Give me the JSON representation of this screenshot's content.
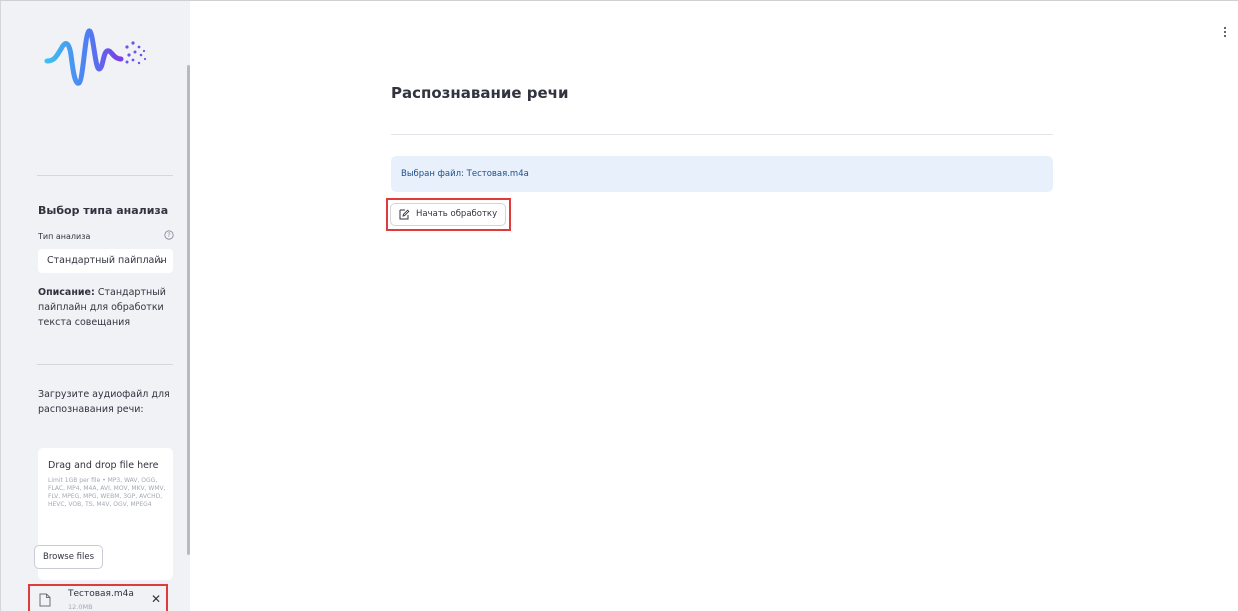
{
  "colors": {
    "sidebar_bg": "#f0f2f6",
    "info_bg": "#e8f1fb",
    "info_text": "#1f4e8a",
    "highlight": "#e03a3a",
    "logo_gradient": [
      "#3ec0f0",
      "#4f7df3",
      "#7b3fe4"
    ]
  },
  "sidebar": {
    "logo": "waveform-logo",
    "section_title": "Выбор типа анализа",
    "analysis_type": {
      "label": "Тип анализа",
      "help_icon": "question-circle-icon",
      "selected": "Стандартный пайплайн",
      "chevron_icon": "chevron-down-icon"
    },
    "description": {
      "label": "Описание:",
      "text": " Стандартный пайплайн для обработки текста совещания"
    },
    "upload": {
      "label": "Загрузите аудиофайл для распознавания речи:",
      "dropzone_title": "Drag and drop file here",
      "limit_text": "Limit 1GB per file • MP3, WAV, OGG, FLAC, MP4, M4A, AVI, MOV, MKV, WMV, FLV, MPEG, MPG, WEBM, 3GP, AVCHD, HEVC, VOB, TS, M4V, OGV, MPEG4",
      "browse_label": "Browse files"
    },
    "file": {
      "icon": "file-icon",
      "name": "Тестовая.m4a",
      "size": "12.0MB",
      "close_icon": "close-icon"
    }
  },
  "main": {
    "menu_icon": "more-vertical-icon",
    "title": "Распознавание речи",
    "info_text": "Выбран файл: Тестовая.m4a",
    "start_button": {
      "icon": "edit-document-icon",
      "label": "Начать обработку"
    }
  }
}
